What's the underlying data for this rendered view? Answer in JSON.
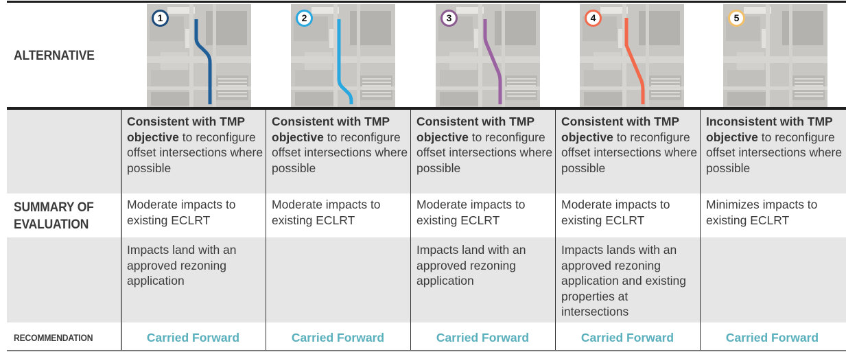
{
  "row_labels": {
    "alternative": "ALTERNATIVE",
    "summary": "SUMMARY OF EVALUATION",
    "summary_line1": "SUMMARY OF",
    "summary_line2": "EVALUATION",
    "recommendation": "RECOMMENDATION"
  },
  "alternatives": [
    {
      "number": "1",
      "route_color": "#1f5e96",
      "badge_color": "#1b4a7a",
      "criteria": [
        {
          "bold": "Consistent with TMP objective",
          "rest": " to reconfigure offset intersections where possible"
        },
        {
          "bold": "",
          "rest": "Moderate impacts to existing ECLRT"
        },
        {
          "bold": "",
          "rest": "Impacts land with an approved rezoning application"
        }
      ],
      "recommendation": "Carried Forward"
    },
    {
      "number": "2",
      "route_color": "#29a8df",
      "badge_color": "#29a8df",
      "criteria": [
        {
          "bold": "Consistent with TMP objective",
          "rest": " to reconfigure offset intersections where possible"
        },
        {
          "bold": "",
          "rest": "Moderate impacts to existing ECLRT"
        },
        {
          "bold": "",
          "rest": ""
        }
      ],
      "recommendation": "Carried Forward"
    },
    {
      "number": "3",
      "route_color": "#9a62a0",
      "badge_color": "#8a5a90",
      "criteria": [
        {
          "bold": "Consistent with TMP objective",
          "rest": " to reconfigure offset intersections where possible"
        },
        {
          "bold": "",
          "rest": "Moderate impacts to existing ECLRT"
        },
        {
          "bold": "",
          "rest": "Impacts land with an approved rezoning application"
        }
      ],
      "recommendation": "Carried Forward"
    },
    {
      "number": "4",
      "route_color": "#f26a4b",
      "badge_color": "#f26a4b",
      "criteria": [
        {
          "bold": "Consistent with TMP objective",
          "rest": " to reconfigure offset intersections where possible"
        },
        {
          "bold": "",
          "rest": "Moderate impacts to existing ECLRT"
        },
        {
          "bold": "",
          "rest": "Impacts lands with an approved rezoning application and existing properties at intersections"
        }
      ],
      "recommendation": "Carried Forward"
    },
    {
      "number": "5",
      "route_color": "",
      "badge_color": "#f3c06a",
      "criteria": [
        {
          "bold": "Inconsistent with TMP objective",
          "rest": " to reconfigure offset intersections where possible"
        },
        {
          "bold": "",
          "rest": "Minimizes impacts to existing ECLRT"
        },
        {
          "bold": "",
          "rest": ""
        }
      ],
      "recommendation": "Carried Forward"
    }
  ],
  "colors": {
    "recommendation_text": "#5ab0bd",
    "band_gray": "#e6e6e6"
  }
}
